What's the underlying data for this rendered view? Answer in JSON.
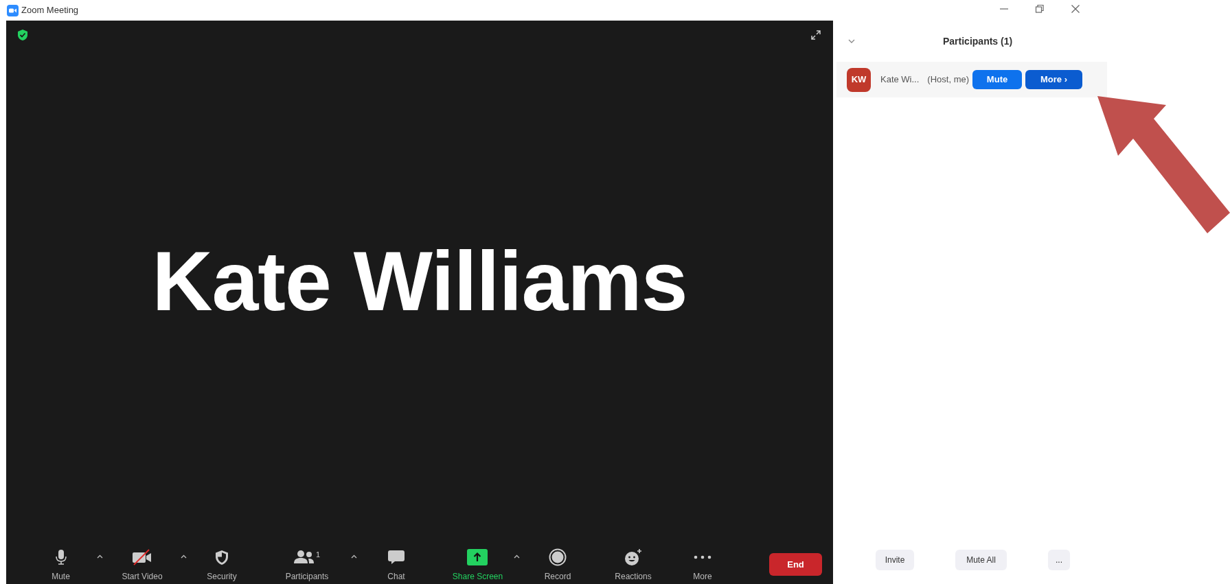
{
  "window": {
    "title": "Zoom Meeting"
  },
  "video": {
    "name": "Kate Williams",
    "encrypted": true
  },
  "toolbar": [
    {
      "kind": "mic",
      "label": "Mute",
      "has_menu": true,
      "highlighted": false
    },
    {
      "kind": "video",
      "label": "Start Video",
      "has_menu": true,
      "off": true,
      "highlighted": false
    },
    {
      "kind": "security",
      "label": "Security",
      "has_menu": false,
      "highlighted": false
    },
    {
      "kind": "participants",
      "label": "Participants",
      "count": "1",
      "has_menu": true,
      "highlighted": false
    },
    {
      "kind": "chat",
      "label": "Chat",
      "has_menu": false,
      "highlighted": false
    },
    {
      "kind": "share",
      "label": "Share Screen",
      "has_menu": true,
      "highlighted": true
    },
    {
      "kind": "record",
      "label": "Record",
      "has_menu": false,
      "highlighted": false
    },
    {
      "kind": "reactions",
      "label": "Reactions",
      "has_menu": false,
      "highlighted": false
    },
    {
      "kind": "more",
      "label": "More",
      "has_menu": false,
      "highlighted": false
    }
  ],
  "end_button": "End",
  "participants_panel": {
    "title": "Participants (1)",
    "participants": [
      {
        "initials": "KW",
        "color": "#c0392b",
        "name": "Kate Wi...",
        "role": "(Host, me)",
        "buttons": [
          "Mute",
          "More ›"
        ]
      }
    ],
    "footer_buttons": [
      "Invite",
      "Mute All",
      "..."
    ]
  }
}
